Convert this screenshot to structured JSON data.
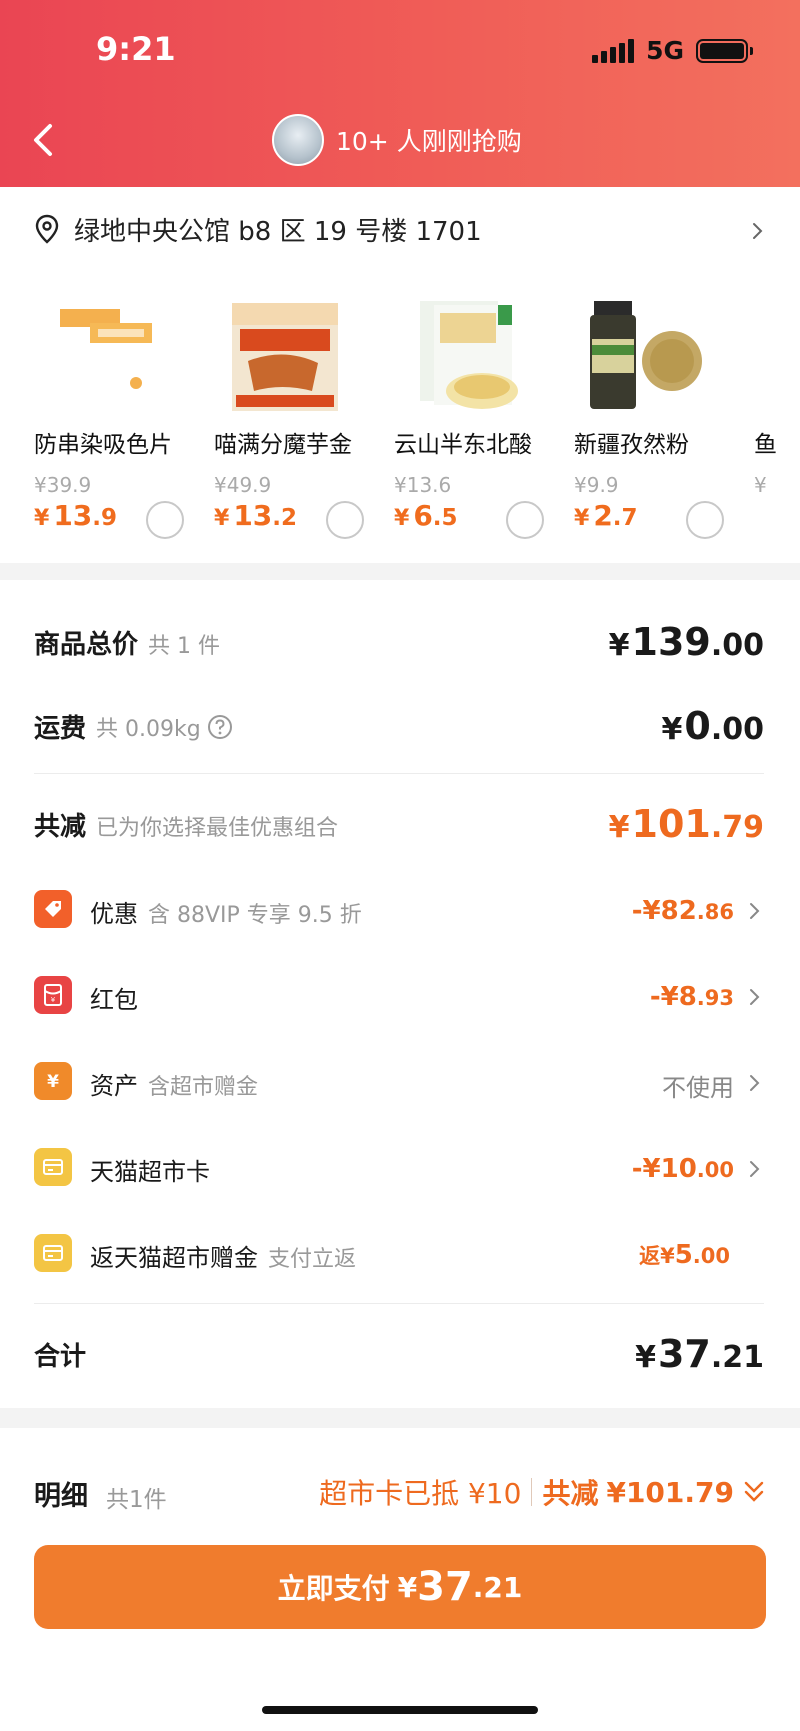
{
  "status_bar": {
    "time": "9:21",
    "network": "5G"
  },
  "nav": {
    "back_label": "返回",
    "buyers_text": "10+ 人刚刚抢购"
  },
  "address": {
    "text": "绿地中央公馆 b8 区 19 号楼 1701"
  },
  "recommendations": [
    {
      "name": "防串染吸色片",
      "original_price": "¥39.9",
      "price_int": "13",
      "price_dec": ".9"
    },
    {
      "name": "喵满分魔芋金",
      "original_price": "¥49.9",
      "price_int": "13",
      "price_dec": ".2"
    },
    {
      "name": "云山半东北酸",
      "original_price": "¥13.6",
      "price_int": "6",
      "price_dec": ".5"
    },
    {
      "name": "新疆孜然粉",
      "original_price": "¥9.9",
      "price_int": "2",
      "price_dec": ".7"
    },
    {
      "name": "鱼",
      "original_price": "¥",
      "price_int": "",
      "price_dec": ""
    }
  ],
  "currency_symbol": "¥",
  "summary": {
    "goods_total": {
      "label": "商品总价",
      "sub": "共 1 件",
      "int": "139",
      "dec": ".00"
    },
    "shipping": {
      "label": "运费",
      "sub": "共 0.09kg",
      "int": "0",
      "dec": ".00"
    },
    "total_discount": {
      "label": "共减",
      "sub": "已为你选择最佳优惠组合",
      "int": "101",
      "dec": ".79"
    },
    "discounts": [
      {
        "label": "优惠",
        "hint": "含 88VIP 专享 9.5 折",
        "amount_prefix": "-¥",
        "amount_int": "82",
        "amount_dec": ".86",
        "icon": "tag-icon",
        "color": "#f2602a"
      },
      {
        "label": "红包",
        "hint": "",
        "amount_prefix": "-¥",
        "amount_int": "8",
        "amount_dec": ".93",
        "icon": "red-packet-icon",
        "color": "#e84444"
      },
      {
        "label": "资产",
        "hint": "含超市赠金",
        "amount_text": "不使用",
        "icon": "yen-icon",
        "color": "#f08a2a"
      },
      {
        "label": "天猫超市卡",
        "hint": "",
        "amount_prefix": "-¥",
        "amount_int": "10",
        "amount_dec": ".00",
        "icon": "card-icon",
        "color": "#f3c544"
      },
      {
        "label": "返天猫超市赠金",
        "hint": "支付立返",
        "amount_prefix": "返¥",
        "amount_int": "5",
        "amount_dec": ".00",
        "icon": "card-icon",
        "color": "#f3c544"
      }
    ],
    "total": {
      "label": "合计",
      "int": "37",
      "dec": ".21"
    }
  },
  "bottom_bar": {
    "detail_label": "明细",
    "detail_count": "共1件",
    "card_deducted": "超市卡已抵 ¥10",
    "total_reduce_label": "共减",
    "total_reduce_amount": "¥101.79",
    "pay_label": "立即支付",
    "pay_int": "37",
    "pay_dec": ".21"
  },
  "colors": {
    "accent_orange": "#ee6a1f",
    "header_red": "#ea4553",
    "pay_button": "#f07c2d"
  }
}
